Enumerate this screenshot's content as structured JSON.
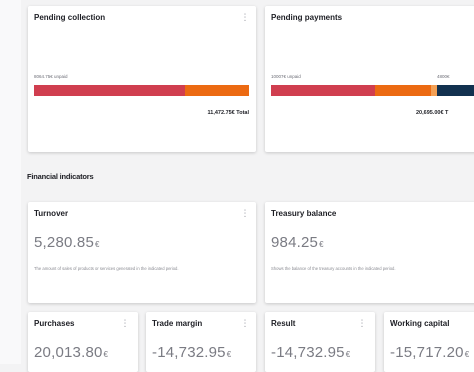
{
  "pending_collection": {
    "title": "Pending collection",
    "unpaid_label": "8064.75€ unpaid",
    "total": "11,472.75€ Total",
    "unpaid_fraction": 0.703,
    "colors": {
      "unpaid": "#d03e4f",
      "paid": "#ec6a12"
    }
  },
  "pending_payments": {
    "title": "Pending payments",
    "unpaid_label": "10007€ unpaid",
    "mid_label": "4800€",
    "total": "20,695.00€ T",
    "colors": {
      "unpaid": "#d03e4f",
      "second": "#ec6a12",
      "third": "#f3a055",
      "fourth": "#12314f"
    }
  },
  "financial_indicators": {
    "title": "Financial indicators"
  },
  "kpis": {
    "turnover": {
      "title": "Turnover",
      "value": "5,280.85",
      "currency": "€",
      "description": "The amount of sales of products or services generated in the indicated period."
    },
    "treasury": {
      "title": "Treasury balance",
      "value": "984.25",
      "currency": "€",
      "description": "Shows the balance of the treasury accounts in the indicated period."
    },
    "purchases": {
      "title": "Purchases",
      "value": "20,013.80",
      "currency": "€"
    },
    "trade_margin": {
      "title": "Trade margin",
      "value": "-14,732.95",
      "currency": "€"
    },
    "result": {
      "title": "Result",
      "value": "-14,732.95",
      "currency": "€"
    },
    "working_capital": {
      "title": "Working capital",
      "value": "-15,717.20",
      "currency": "€"
    }
  },
  "menu_icon": "kebab-menu-icon"
}
